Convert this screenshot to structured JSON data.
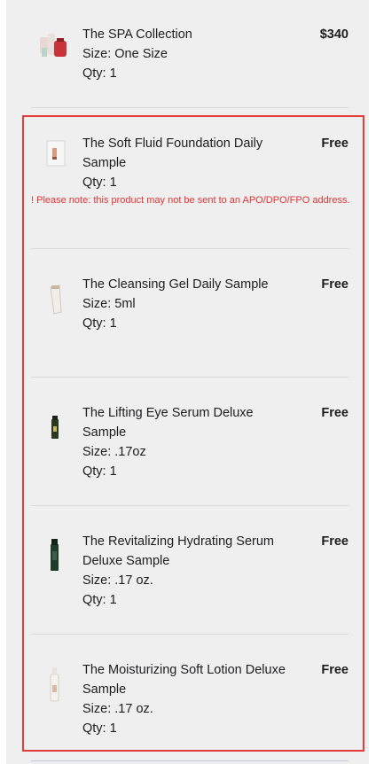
{
  "items": [
    {
      "name": "The SPA Collection",
      "details": [
        "Size: One Size",
        "Qty: 1"
      ],
      "price": "$340",
      "icon": "spa-collection-icon"
    },
    {
      "name": "The Soft Fluid Foundation Daily Sample",
      "details": [
        "Qty: 1"
      ],
      "price": "Free",
      "icon": "foundation-sample-icon"
    },
    {
      "name": "The Cleansing Gel Daily Sample",
      "details": [
        "Size: 5ml",
        "Qty: 1"
      ],
      "price": "Free",
      "icon": "cleansing-gel-icon"
    },
    {
      "name": "The Lifting Eye Serum Deluxe Sample",
      "details": [
        "Size: .17oz",
        "Qty: 1"
      ],
      "price": "Free",
      "icon": "eye-serum-icon"
    },
    {
      "name": "The Revitalizing Hydrating Serum Deluxe Sample",
      "details": [
        "Size: .17 oz.",
        "Qty: 1"
      ],
      "price": "Free",
      "icon": "hydrating-serum-icon"
    },
    {
      "name": "The Moisturizing Soft Lotion Deluxe Sample",
      "details": [
        "Size: .17 oz.",
        "Qty: 1"
      ],
      "price": "Free",
      "icon": "soft-lotion-icon"
    }
  ],
  "notice": "! Please note: this product may not be sent to an APO/DPO/FPO address.",
  "colors": {
    "panel_bg": "#efefef",
    "notice_text": "#e03535",
    "highlight_border": "#e53b3b"
  }
}
